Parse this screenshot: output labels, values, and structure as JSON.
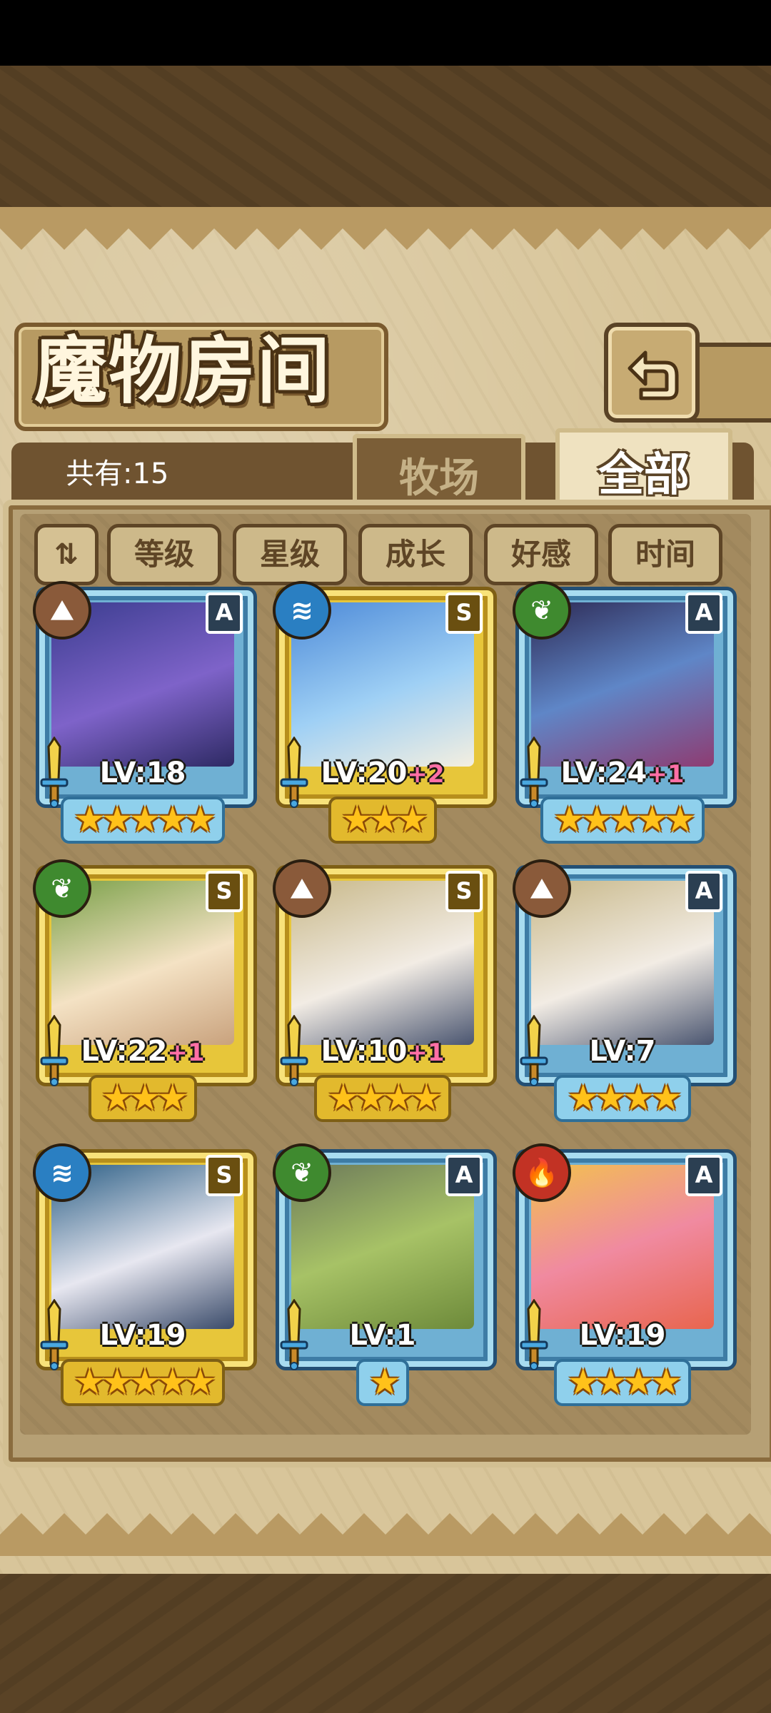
{
  "title": "魔物房间",
  "count_label": "共有:15",
  "tabs": {
    "pasture": "牧场",
    "all": "全部"
  },
  "filters": {
    "toggle_icon": "sort-toggle-icon",
    "items": [
      "等级",
      "星级",
      "成长",
      "好感",
      "时间"
    ]
  },
  "monsters": [
    {
      "element": "earth",
      "grade": "A",
      "level": "LV:18",
      "bonus": "",
      "stars": 5,
      "rarity": "blue"
    },
    {
      "element": "water",
      "grade": "S",
      "level": "LV:20",
      "bonus": "+2",
      "stars": 3,
      "rarity": "gold"
    },
    {
      "element": "wood",
      "grade": "A",
      "level": "LV:24",
      "bonus": "+1",
      "stars": 5,
      "rarity": "blue"
    },
    {
      "element": "wood",
      "grade": "S",
      "level": "LV:22",
      "bonus": "+1",
      "stars": 3,
      "rarity": "gold"
    },
    {
      "element": "earth",
      "grade": "S",
      "level": "LV:10",
      "bonus": "+1",
      "stars": 4,
      "rarity": "gold"
    },
    {
      "element": "earth",
      "grade": "A",
      "level": "LV:7",
      "bonus": "",
      "stars": 4,
      "rarity": "blue"
    },
    {
      "element": "water",
      "grade": "S",
      "level": "LV:19",
      "bonus": "",
      "stars": 5,
      "rarity": "gold"
    },
    {
      "element": "wood",
      "grade": "A",
      "level": "LV:1",
      "bonus": "",
      "stars": 1,
      "rarity": "blue"
    },
    {
      "element": "fire",
      "grade": "A",
      "level": "LV:19",
      "bonus": "",
      "stars": 4,
      "rarity": "blue"
    }
  ],
  "colors": {
    "gold_frame": "#e7c63a",
    "blue_frame": "#6fb0d3",
    "star": "#ffc21a",
    "bonus": "#ff6fa6"
  }
}
